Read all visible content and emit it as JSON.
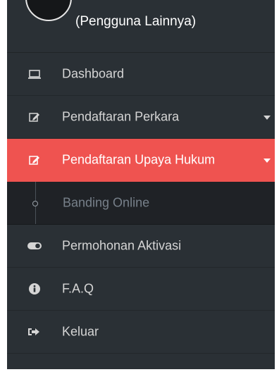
{
  "sidebar": {
    "user_role": "(Pengguna Lainnya)",
    "items": [
      {
        "label": "Dashboard",
        "icon": "laptop-icon"
      },
      {
        "label": "Pendaftaran Perkara",
        "icon": "edit-icon",
        "has_dropdown": true
      },
      {
        "label": "Pendaftaran Upaya Hukum",
        "icon": "edit-icon",
        "has_dropdown": true,
        "active": true
      },
      {
        "label": "Banding Online",
        "icon": "bullet-icon",
        "submenu": true
      },
      {
        "label": "Permohonan Aktivasi",
        "icon": "toggle-icon"
      },
      {
        "label": "F.A.Q",
        "icon": "info-icon"
      },
      {
        "label": "Keluar",
        "icon": "logout-icon"
      }
    ]
  },
  "colors": {
    "sidebar_bg": "#2a3035",
    "active_bg": "#ef5350",
    "submenu_bg": "#1f2226",
    "text": "#d5d5d5"
  }
}
